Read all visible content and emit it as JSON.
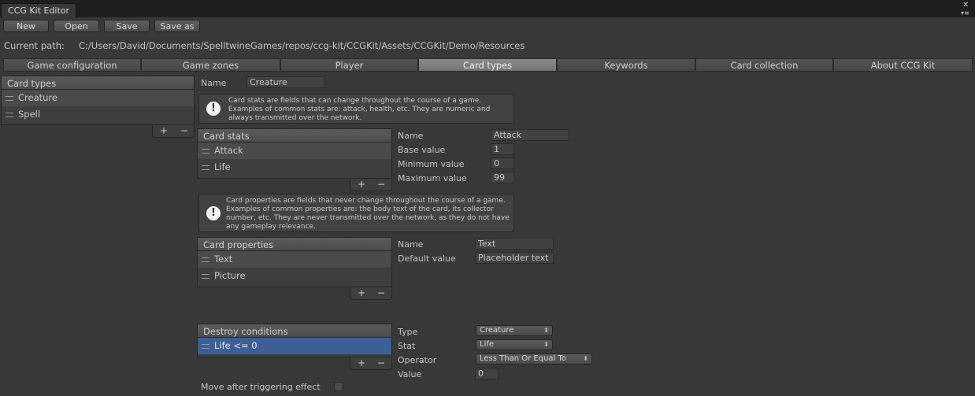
{
  "window": {
    "title": "CCG Kit Editor",
    "menu_icon": "menu-icon",
    "close_icon": "close-icon"
  },
  "toolbar": {
    "new_label": "New",
    "open_label": "Open",
    "save_label": "Save",
    "save_as_label": "Save as"
  },
  "path": {
    "label": "Current path:",
    "value": "C:/Users/David/Documents/SpelltwineGames/repos/ccg-kit/CCGKit/Assets/CCGKit/Demo/Resources"
  },
  "tabs": [
    {
      "label": "Game configuration"
    },
    {
      "label": "Game zones"
    },
    {
      "label": "Player"
    },
    {
      "label": "Card types"
    },
    {
      "label": "Keywords"
    },
    {
      "label": "Card collection"
    },
    {
      "label": "About CCG Kit"
    }
  ],
  "card_types": {
    "header": "Card types",
    "items": [
      {
        "label": "Creature"
      },
      {
        "label": "Spell"
      }
    ]
  },
  "card_type_name": {
    "label": "Name",
    "value": "Creature"
  },
  "stats_help": {
    "text": "Card stats are fields that can change throughout the course of a game. Examples of common stats are: attack, health, etc. They are numeric and always transmitted over the network."
  },
  "card_stats": {
    "header": "Card stats",
    "items": [
      {
        "label": "Attack"
      },
      {
        "label": "Life"
      }
    ],
    "detail": {
      "name_label": "Name",
      "name_value": "Attack",
      "base_label": "Base value",
      "base_value": "1",
      "min_label": "Minimum value",
      "min_value": "0",
      "max_label": "Maximum value",
      "max_value": "99"
    }
  },
  "props_help": {
    "text": "Card properties are fields that never change throughout the course of a game. Examples of common properties are: the body text of the card, its collector number, etc. They are never transmitted over the network, as they do not have any gameplay relevance."
  },
  "card_properties": {
    "header": "Card properties",
    "items": [
      {
        "label": "Text"
      },
      {
        "label": "Picture"
      }
    ],
    "detail": {
      "name_label": "Name",
      "name_value": "Text",
      "default_label": "Default value",
      "default_value": "Placeholder text"
    }
  },
  "destroy_conditions": {
    "header": "Destroy conditions",
    "items": [
      {
        "label": "Life <= 0"
      }
    ],
    "detail": {
      "type_label": "Type",
      "type_value": "Creature",
      "stat_label": "Stat",
      "stat_value": "Life",
      "operator_label": "Operator",
      "operator_value": "Less Than Or Equal To",
      "value_label": "Value",
      "value_value": "0"
    }
  },
  "move_after": {
    "label": "Move after triggering effect",
    "checked": false
  },
  "list_footer": {
    "add": "+",
    "remove": "−"
  },
  "colors": {
    "background": "#383838",
    "selection": "#3e5f96",
    "active_tab": "#7e7e7e"
  }
}
